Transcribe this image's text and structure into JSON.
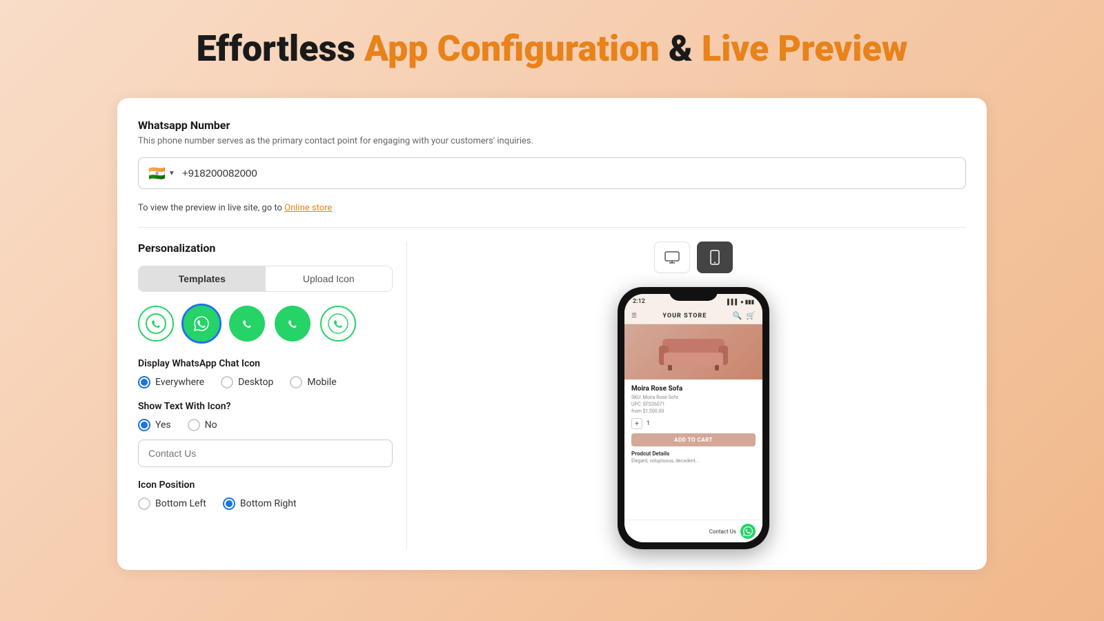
{
  "page": {
    "title_part1": "Effortless",
    "title_part2": "App Configuration",
    "title_part3": "&",
    "title_part4": "Live Preview"
  },
  "whatsapp_section": {
    "label": "Whatsapp Number",
    "description": "This phone number serves as the primary contact point for engaging with your customers' inquiries.",
    "phone_flag": "🇮🇳",
    "phone_number": "+918200082000",
    "preview_note": "To view the preview in live site, go to",
    "preview_link_text": "Online store"
  },
  "personalization": {
    "title": "Personalization",
    "tabs": {
      "templates_label": "Templates",
      "upload_icon_label": "Upload Icon"
    },
    "display_icon_label": "Display WhatsApp Chat Icon",
    "display_options": [
      {
        "id": "everywhere",
        "label": "Everywhere",
        "selected": true
      },
      {
        "id": "desktop",
        "label": "Desktop",
        "selected": false
      },
      {
        "id": "mobile",
        "label": "Mobile",
        "selected": false
      }
    ],
    "show_text_label": "Show Text With Icon?",
    "show_text_options": [
      {
        "id": "yes",
        "label": "Yes",
        "selected": true
      },
      {
        "id": "no",
        "label": "No",
        "selected": false
      }
    ],
    "contact_text_placeholder": "Contact Us",
    "icon_position_label": "Icon Position",
    "icon_position_options": [
      {
        "id": "bottom_left",
        "label": "Bottom Left",
        "selected": false
      },
      {
        "id": "bottom_right",
        "label": "Bottom Right",
        "selected": true
      }
    ]
  },
  "preview": {
    "device_options": [
      "desktop",
      "mobile"
    ],
    "store_name": "YOUR STORE",
    "product_name": "Moira Rose Sofa",
    "sku": "SKU: Moira Rose Sofa",
    "upc": "UPC: EFS26071",
    "price": "from $1,500.00",
    "quantity": "1",
    "add_to_cart": "ADD TO CART",
    "product_details_header": "Prodcut Details",
    "product_description": "Elegant, voluptuous, decadent...",
    "phone_time": "2:12",
    "contact_us_label": "Contact Us"
  },
  "colors": {
    "orange": "#e8821a",
    "black": "#1a1a1a",
    "green": "#25d366",
    "blue": "#1a73e8"
  }
}
